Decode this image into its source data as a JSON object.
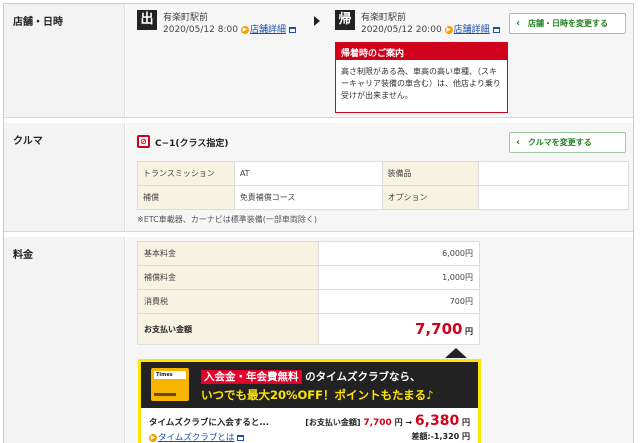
{
  "store": {
    "section_label": "店舗・日時",
    "depart": {
      "badge": "出",
      "name": "有楽町駅前",
      "datetime": "2020/05/12 8:00",
      "detail_link": "店舗詳細"
    },
    "return": {
      "badge": "帰",
      "name": "有楽町駅前",
      "datetime": "2020/05/12 20:00",
      "detail_link": "店舗詳細"
    },
    "notice": {
      "title": "帰着時のご案内",
      "body": "高さ制限がある為、車高の高い車種、（スキーキャリア装備の車含む）は、他店より乗り受けが出来ません。"
    },
    "change_button": "店舗・日時を変更する"
  },
  "car": {
    "section_label": "クルマ",
    "class_name": "C−1(クラス指定)",
    "change_button": "クルマを変更する",
    "specs": [
      {
        "label": "トランスミッション",
        "value": "AT",
        "label2": "装備品",
        "value2": ""
      },
      {
        "label": "補償",
        "value": "免責補償コース",
        "label2": "オプション",
        "value2": ""
      }
    ],
    "note": "※ETC車載器、カーナビは標準装備(一部車両除く)"
  },
  "price": {
    "section_label": "料金",
    "rows": [
      {
        "label": "基本料金",
        "value": "6,000円"
      },
      {
        "label": "補償料金",
        "value": "1,000円"
      },
      {
        "label": "消費税",
        "value": "700円"
      }
    ],
    "total_label": "お支払い金額",
    "total_value": "7,700",
    "total_unit": "円"
  },
  "banner": {
    "card_text": "Times",
    "line1_red": "入会金・年会費無料",
    "line1_rest": "のタイムズクラブなら、",
    "line2": "いつでも最大20%OFF！ポイントもたまる♪",
    "join_text": "タイムズクラブに入会すると...",
    "about_link": "タイムズクラブとは",
    "pay_label": "[お支払い金額]",
    "old_price": "7,700",
    "old_unit": "円 →",
    "new_price": "6,380",
    "new_unit": "円",
    "discount": "差額:-1,320 円"
  },
  "colors": {
    "accent_red": "#d0021b",
    "button_green": "#1e7e1e",
    "banner_yellow": "#ffe400"
  }
}
